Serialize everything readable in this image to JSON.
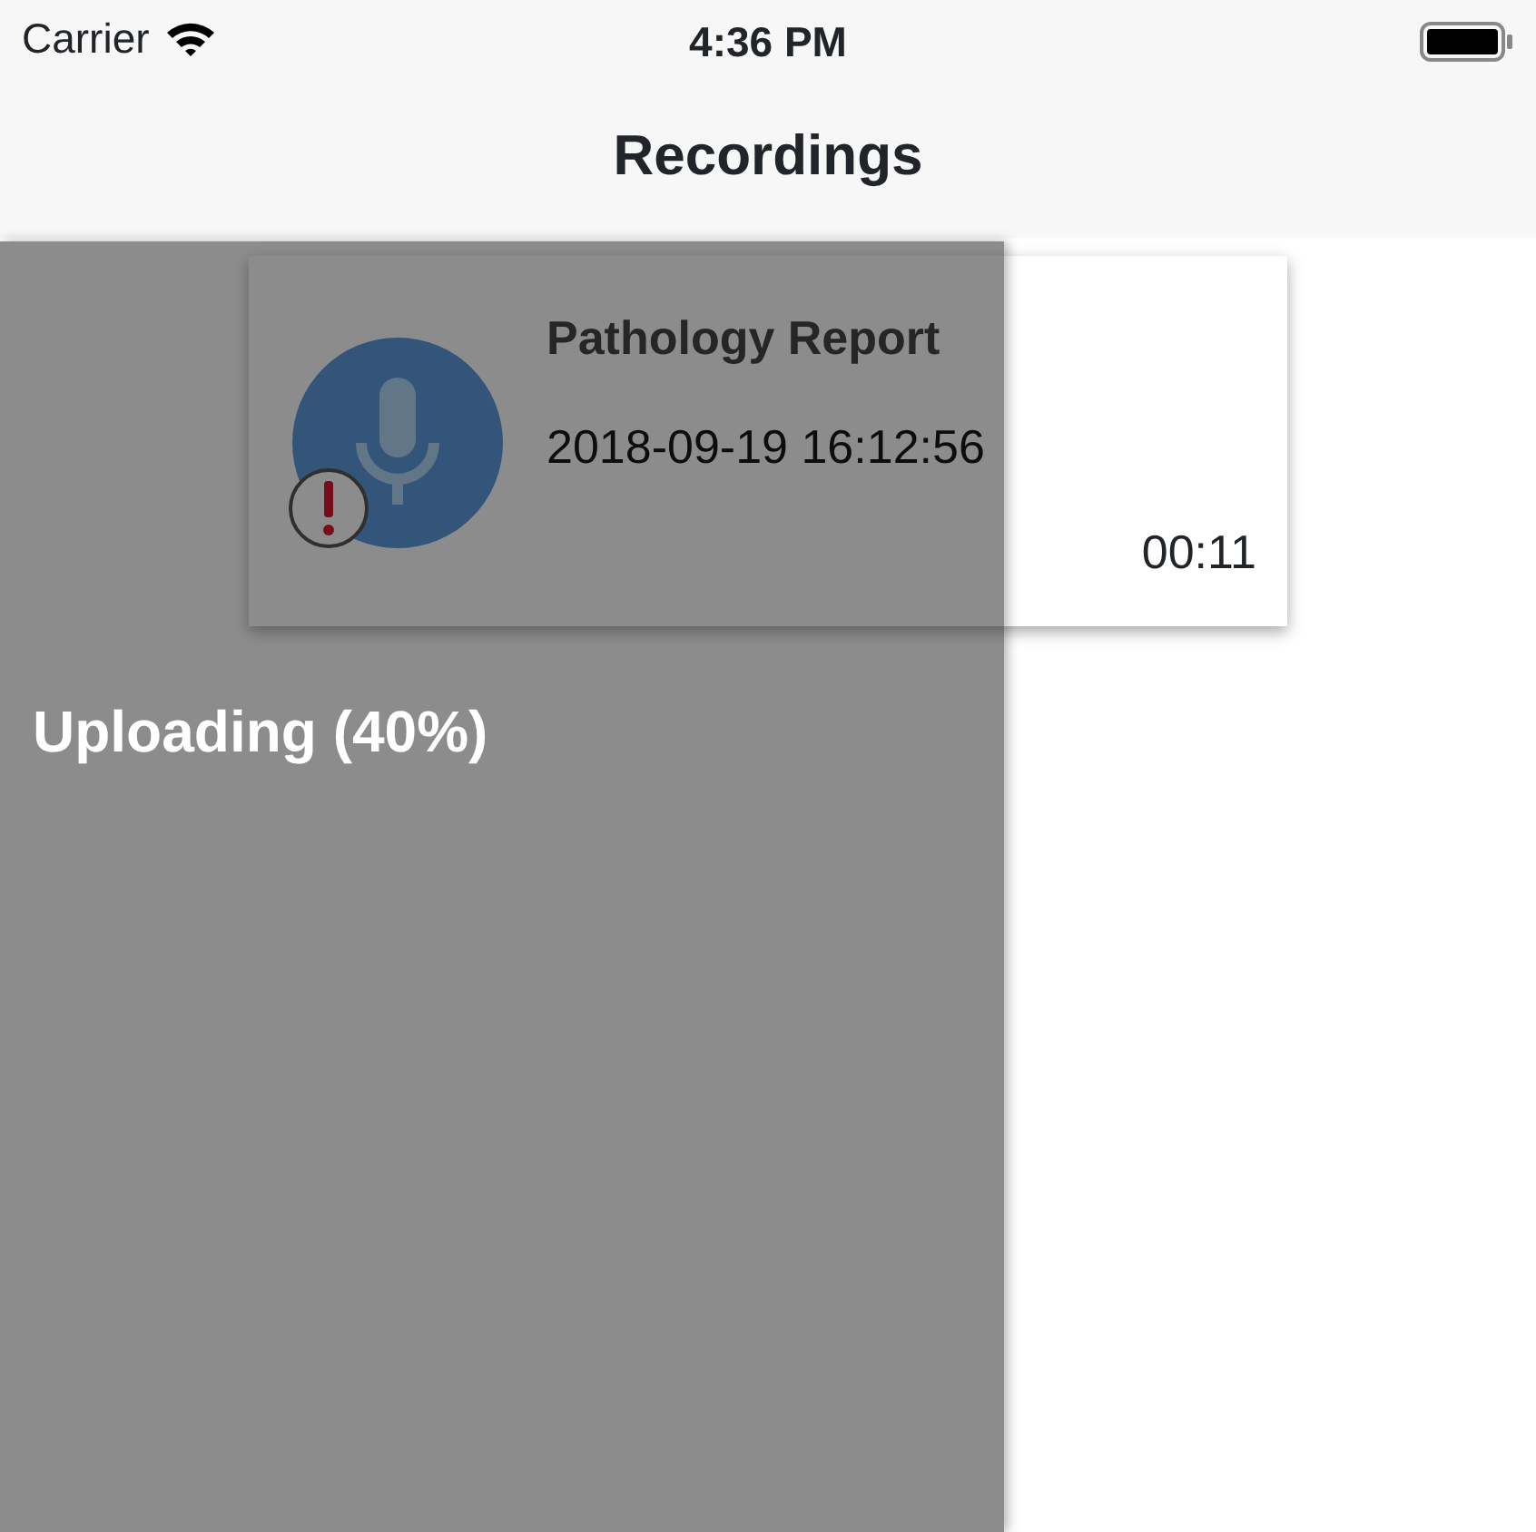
{
  "status_bar": {
    "carrier": "Carrier",
    "time": "4:36 PM"
  },
  "nav_bar": {
    "title": "Recordings"
  },
  "recordings": [
    {
      "title": "Pathology Report",
      "date": "2018-09-19 16:12:56",
      "duration": "00:11",
      "error": true
    }
  ],
  "upload_overlay": {
    "message": "Uploading (40%)"
  }
}
